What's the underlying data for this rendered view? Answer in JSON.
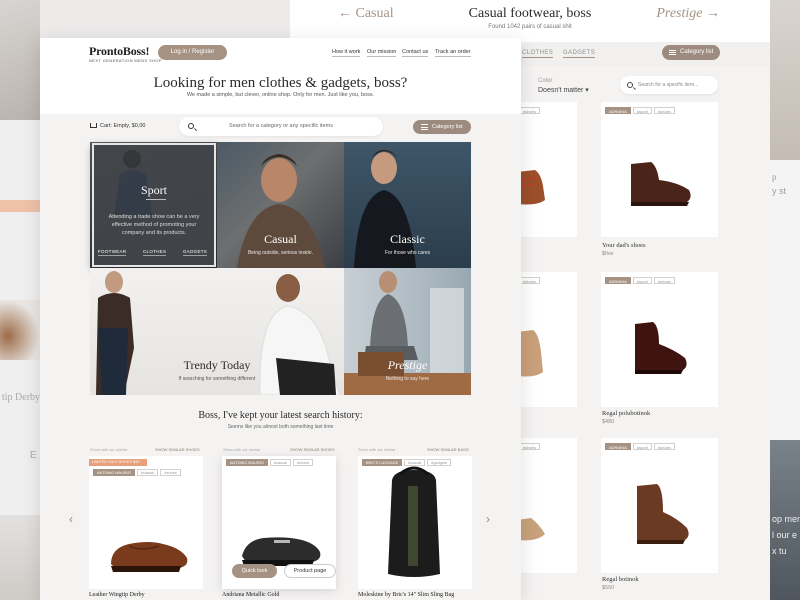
{
  "background_left": {
    "labels": [
      "tip Derby",
      "E"
    ]
  },
  "background_right": {
    "labels": [
      "p",
      "y st",
      "op men",
      "l our e",
      "x tu"
    ]
  },
  "listing": {
    "prev": "← Casual",
    "next": "Prestige →",
    "title": "Casual footwear, boss",
    "subtitle": "Found 1042 pairs of casual shit",
    "nav": [
      "CLOTHES",
      "GADGETS"
    ],
    "category_button": "Category list",
    "color_label": "Color",
    "color_value": "Doesn't matter ▾",
    "search_placeholder": "Search for a specific item...",
    "products": [
      {
        "tags": [
          "ADRIANA",
          "#sport",
          "#shoes"
        ],
        "name": "Your dad's shoes",
        "price": "$five"
      },
      {
        "tags": [
          "ADRIANA",
          "#sport",
          "#shoes"
        ],
        "name": "Regal polubotinok",
        "price": "$480"
      },
      {
        "tags": [
          "ADRIANA",
          "#sport",
          "#shoes"
        ],
        "name": "Regal botinok",
        "price": "$550"
      }
    ],
    "partial_tags": "#shoes"
  },
  "home": {
    "logo": "ProntoBoss!",
    "logo_tagline": "NEXT GENERATION MENS SHOP",
    "login_button": "Log in / Register",
    "nav": [
      "How it work",
      "Our mission",
      "Contact us",
      "Track an order"
    ],
    "hero_title": "Looking for men clothes & gadgets, boss?",
    "hero_subtitle": "We made a simple, but clever, online shop. Only for men. Just like you, boss.",
    "cart": "Cart: Empty, $0,00",
    "search_placeholder": "Search for a category or any specific items",
    "category_button": "Category list",
    "tiles": {
      "sport": {
        "title": "Sport",
        "desc": "Attending a trade show can be a very effective method of promoting your company and its products.",
        "links": [
          "FOOTWEAR",
          "CLOTHES",
          "GADGETS"
        ]
      },
      "casual": {
        "title": "Casual",
        "sub": "Being outside, serious inside."
      },
      "classic": {
        "title": "Classic",
        "sub": "For those who cares"
      },
      "trendy": {
        "title": "Trendy Today",
        "sub": "If searching for something different"
      },
      "prestige": {
        "title": "Prestige",
        "sub": "Nothing to say here"
      }
    },
    "history_title": "Boss, I've kept your latest search history:",
    "history_subtitle": "Seems like you almost both something last time",
    "history_cards": [
      {
        "meta": "Show with ad. similar",
        "show_similar": "SHOW SIMILAR SHOES",
        "ribbon": "LIMITED SALE SHOES $45",
        "tags": [
          "ANTONIO MAURIZI",
          "#classic",
          "#shoes"
        ],
        "name": "Leather Wingtip Derby"
      },
      {
        "meta": "Show with ad. similar",
        "show_similar": "SHOW SIMILAR SHOES",
        "tags": [
          "ANTONIO MAURIZI",
          "#casual",
          "#shoes"
        ],
        "name": "Andriana Metallic Gold",
        "quick_look": "Quick look",
        "product_page": "Product page"
      },
      {
        "meta": "Show with ad. similar",
        "show_similar": "SHOW SIMILAR BAGS",
        "tags": [
          "BRIC'S LUGGAGE",
          "#casual",
          "#gadgets"
        ],
        "name": "Moleskine by Bric's 14\" Slim Sling Bag"
      }
    ]
  },
  "colors": {
    "accent": "#a59283",
    "accent_dark": "#9c8b7e",
    "ribbon": "#e7a07a"
  }
}
